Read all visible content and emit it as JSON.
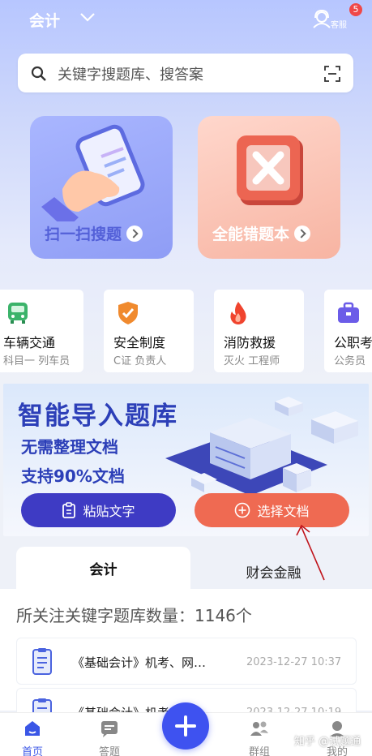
{
  "header": {
    "subject": "会计",
    "cs_label": "客服",
    "badge_count": "5"
  },
  "search": {
    "placeholder": "关键字搜题库、搜答案"
  },
  "feature_cards": [
    {
      "label": "扫一扫搜题"
    },
    {
      "label": "全能错题本"
    }
  ],
  "categories": [
    {
      "title": "车辆交通",
      "subtitle": "科目一 列车员",
      "icon": "bus-icon",
      "color": "#3bb36a"
    },
    {
      "title": "安全制度",
      "subtitle": "C证 负责人",
      "icon": "shield-icon",
      "color": "#f08a2e"
    },
    {
      "title": "消防救援",
      "subtitle": "灭火 工程师",
      "icon": "flame-icon",
      "color": "#f0442e"
    },
    {
      "title": "公职考",
      "subtitle": "公务员",
      "icon": "briefcase-icon",
      "color": "#6b5ce8"
    }
  ],
  "banner": {
    "title": "智能导入题库",
    "line1": "无需整理文档",
    "line2": "支持90%文档",
    "paste_label": "粘贴文字",
    "choose_label": "选择文档"
  },
  "tabs": [
    {
      "label": "会计"
    },
    {
      "label": "财会金融"
    }
  ],
  "content": {
    "keyword_count": "所关注关键字题库数量：1146个",
    "rows": [
      {
        "title": "《基础会计》机考、网…",
        "date": "2023-12-27 10:37"
      },
      {
        "title": "《基础会计》机考、网…",
        "date": "2023-12-27 10:19"
      }
    ]
  },
  "tabbar": [
    {
      "label": "首页",
      "icon": "home-icon"
    },
    {
      "label": "答题",
      "icon": "answer-icon"
    },
    {
      "label": "群组",
      "icon": "group-icon"
    },
    {
      "label": "我的",
      "icon": "profile-icon"
    }
  ],
  "watermark": "知乎 @试题通",
  "colors": {
    "accent": "#3e52f0",
    "banner_blue": "#2c3fb8",
    "choose_orange": "#ef6a52"
  }
}
